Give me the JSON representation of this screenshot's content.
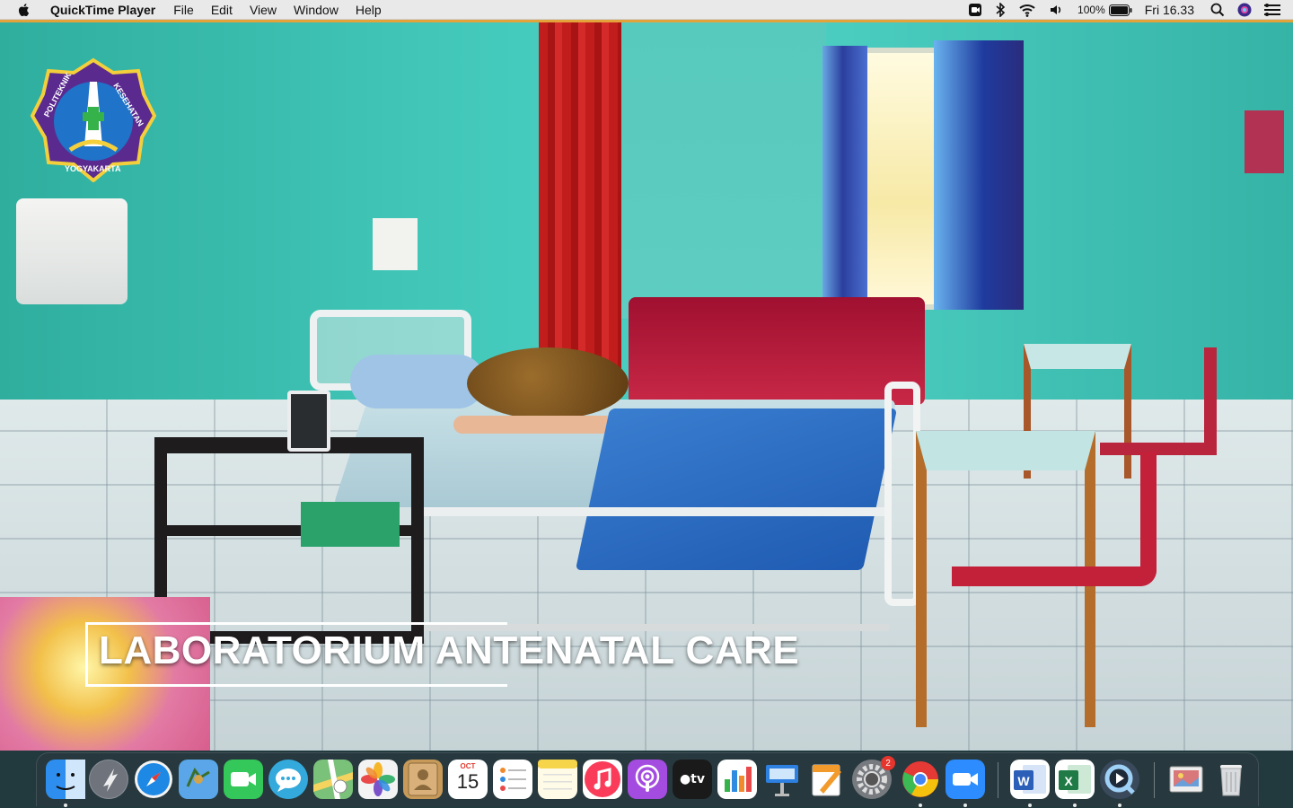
{
  "menubar": {
    "app_name": "QuickTime Player",
    "menus": [
      "File",
      "Edit",
      "View",
      "Window",
      "Help"
    ],
    "battery": "100%",
    "clock": "Fri 16.33"
  },
  "video": {
    "caption": "LABORATORIUM ANTENATAL CARE",
    "logo": {
      "top_left": "POLITEKNIK",
      "top_right": "KESEHATAN",
      "bottom": "YOGYAKARTA"
    }
  },
  "dock": {
    "calendar": {
      "month": "OCT",
      "day": "15"
    },
    "system_preferences_badge": "2",
    "items": [
      {
        "name": "finder-icon",
        "color": "#2d8ef0"
      },
      {
        "name": "launchpad-icon",
        "color": "#8a8f98"
      },
      {
        "name": "safari-icon",
        "color": "#1e88e5"
      },
      {
        "name": "mail-icon",
        "color": "#5aa6e8"
      },
      {
        "name": "facetime-icon",
        "color": "#34c759"
      },
      {
        "name": "messages-icon",
        "color": "#34aadc"
      },
      {
        "name": "maps-icon",
        "color": "#7ac17a"
      },
      {
        "name": "photos-icon",
        "color": "#f3f3f3"
      },
      {
        "name": "contacts-icon",
        "color": "#c79a5a"
      },
      {
        "name": "calendar-icon",
        "color": "#ffffff"
      },
      {
        "name": "reminders-icon",
        "color": "#ffffff"
      },
      {
        "name": "notes-icon",
        "color": "#f7e27a"
      },
      {
        "name": "music-icon",
        "color": "#fa3c5a"
      },
      {
        "name": "podcasts-icon",
        "color": "#a44ce0"
      },
      {
        "name": "tv-icon",
        "color": "#1a1a1a"
      },
      {
        "name": "numbers-icon",
        "color": "#35b24a"
      },
      {
        "name": "keynote-icon",
        "color": "#2d7fe0"
      },
      {
        "name": "pages-icon",
        "color": "#f29b2c"
      },
      {
        "name": "system-preferences-icon",
        "color": "#777b80"
      },
      {
        "name": "chrome-icon",
        "color": "#e0e0e0"
      },
      {
        "name": "zoom-icon",
        "color": "#2d8cff"
      },
      {
        "name": "word-icon",
        "color": "#2b5fb8"
      },
      {
        "name": "excel-icon",
        "color": "#1f7a45"
      },
      {
        "name": "quicktime-icon",
        "color": "#3a4a5c"
      },
      {
        "name": "preview-icon",
        "color": "#c9c9c9"
      },
      {
        "name": "trash-icon",
        "color": "#d8dcdf"
      }
    ]
  }
}
